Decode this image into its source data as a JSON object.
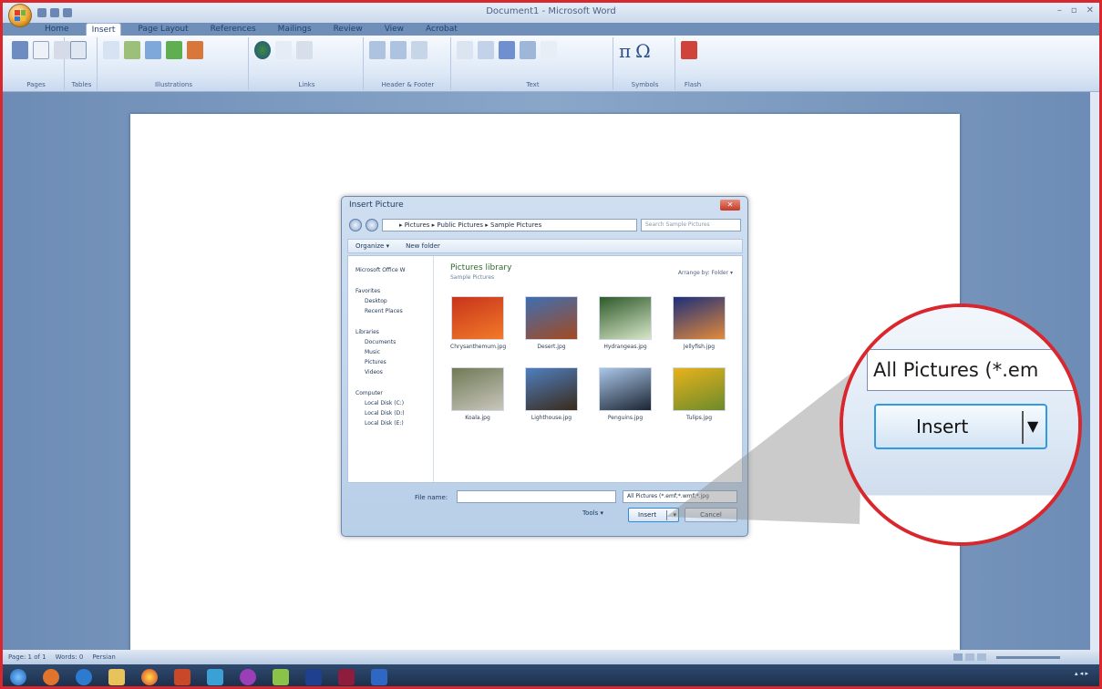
{
  "window": {
    "title": "Document1 - Microsoft Word"
  },
  "ribbon": {
    "tabs": [
      "Home",
      "Insert",
      "Page Layout",
      "References",
      "Mailings",
      "Review",
      "View",
      "Acrobat"
    ],
    "groups": [
      "Pages",
      "Tables",
      "Illustrations",
      "Links",
      "Header & Footer",
      "Text",
      "Symbols",
      "Flash"
    ],
    "symbols": {
      "equation": "π",
      "symbol": "Ω"
    }
  },
  "dialog": {
    "title": "Insert Picture",
    "close_label": "✕",
    "address": "▸ Pictures ▸ Public Pictures ▸ Sample Pictures",
    "search_placeholder": "Search Sample Pictures",
    "toolbar": {
      "organize": "Organize ▾",
      "new_folder": "New folder"
    },
    "nav": {
      "office": "Microsoft Office W",
      "favorites": "Favorites",
      "favorites_items": [
        "Desktop",
        "Recent Places"
      ],
      "libraries": "Libraries",
      "libraries_items": [
        "Documents",
        "Music",
        "Pictures",
        "Videos"
      ],
      "computer": "Computer",
      "computer_items": [
        "Local Disk (C:)",
        "Local Disk (D:)",
        "Local Disk (E:)"
      ]
    },
    "library_title": "Pictures library",
    "library_sub": "Sample Pictures",
    "arrange": "Arrange by:  Folder ▾",
    "thumbnails": [
      {
        "name": "Chrysanthemum.jpg",
        "color1": "#c8341a",
        "color2": "#f27a2a"
      },
      {
        "name": "Desert.jpg",
        "color1": "#3d6fb3",
        "color2": "#a4491f"
      },
      {
        "name": "Hydrangeas.jpg",
        "color1": "#2f5a2b",
        "color2": "#d7e6c8"
      },
      {
        "name": "Jellyfish.jpg",
        "color1": "#1d2f7a",
        "color2": "#e38a3a"
      },
      {
        "name": "Koala.jpg",
        "color1": "#6f7a55",
        "color2": "#c9c6bd"
      },
      {
        "name": "Lighthouse.jpg",
        "color1": "#4f7fc0",
        "color2": "#3a2a1a"
      },
      {
        "name": "Penguins.jpg",
        "color1": "#a9c6e8",
        "color2": "#1c2533"
      },
      {
        "name": "Tulips.jpg",
        "color1": "#e8b21b",
        "color2": "#6b8b2b"
      }
    ],
    "file_name_label": "File name:",
    "file_filter": "All Pictures (*.emf;*.wmf;*.jpg",
    "tools_label": "Tools ▾",
    "insert_label": "Insert",
    "cancel_label": "Cancel"
  },
  "zoom": {
    "filter_text": "All Pictures (*.em",
    "insert_label": "Insert",
    "arrow": "▼"
  },
  "statusbar": {
    "page": "Page: 1 of 1",
    "words": "Words: 0",
    "language": "Persian"
  },
  "colors": {
    "border": "#d9272e",
    "insert_highlight": "#2f9be0"
  }
}
